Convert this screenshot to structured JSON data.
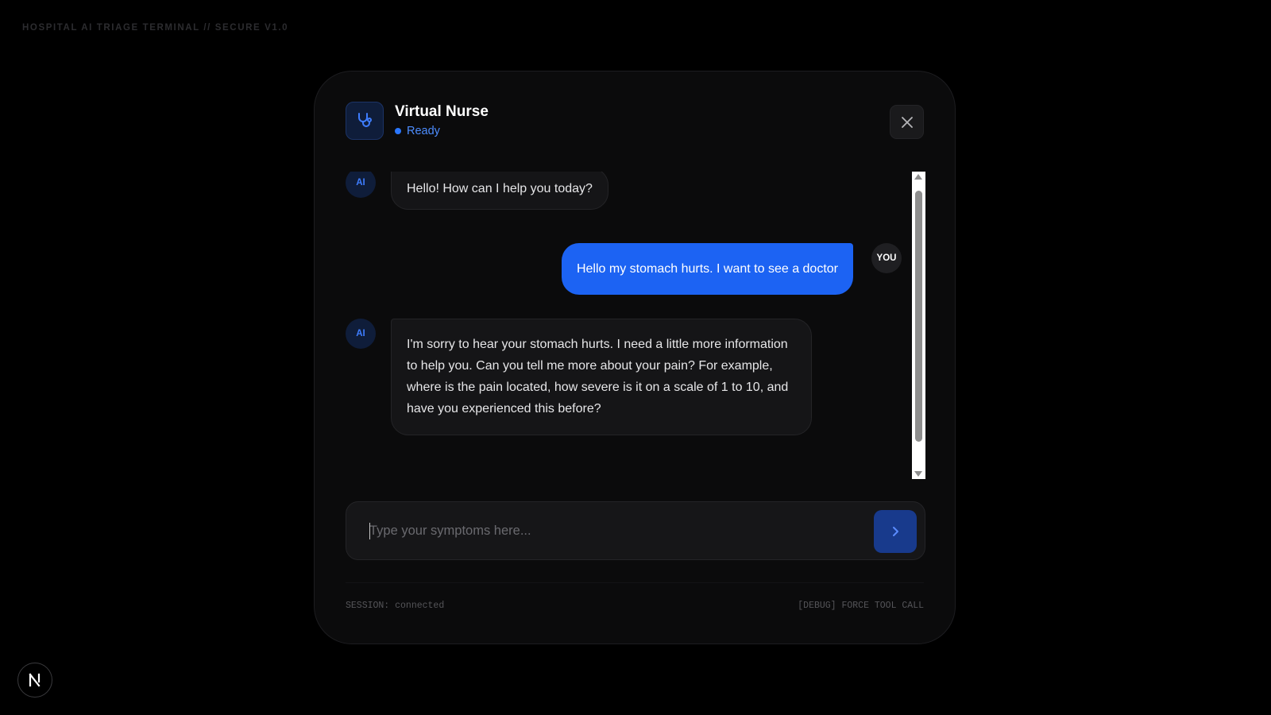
{
  "app": {
    "terminal_title": "HOSPITAL AI TRIAGE TERMINAL // SECURE V1.0"
  },
  "header": {
    "title": "Virtual Nurse",
    "status": "Ready",
    "logo_icon": "stethoscope-icon",
    "close_icon": "close-icon"
  },
  "chat": {
    "messages": [
      {
        "role": "ai",
        "avatar": "AI",
        "text": "Hello! How can I help you today?"
      },
      {
        "role": "user",
        "avatar": "YOU",
        "text": "Hello my stomach hurts. I want to see a doctor"
      },
      {
        "role": "ai",
        "avatar": "AI",
        "text": "I'm sorry to hear your stomach hurts. I need a little more information to help you. Can you tell me more about your pain? For example, where is the pain located, how severe is it on a scale of 1 to 10, and have you experienced this before?"
      }
    ]
  },
  "input": {
    "value": "",
    "placeholder": "Type your symptoms here...",
    "send_icon": "chevron-right-icon"
  },
  "footer": {
    "session": "SESSION: connected",
    "debug": "[DEBUG] FORCE TOOL CALL"
  },
  "badge": {
    "label": "N"
  },
  "colors": {
    "accent": "#1c63f3",
    "status": "#4d8dff",
    "background": "#000000",
    "panel": "#0b0b0c"
  }
}
